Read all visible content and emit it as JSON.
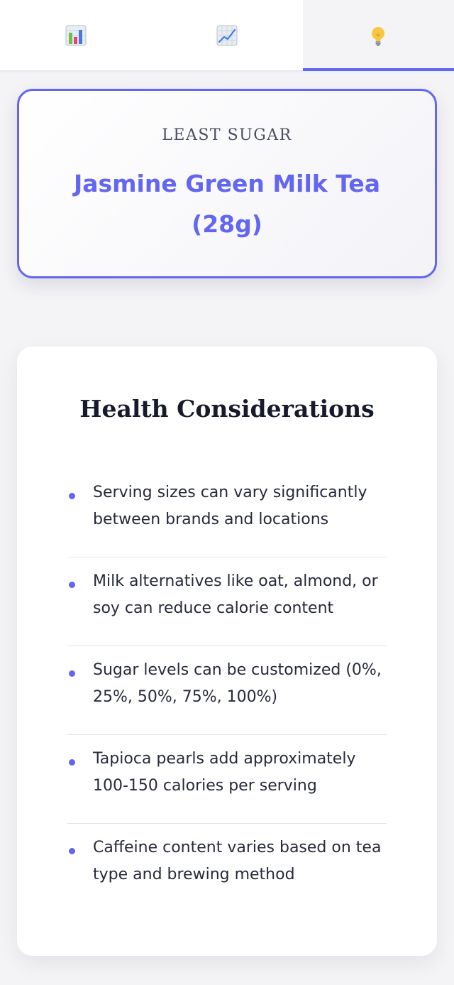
{
  "tabs": [
    {
      "icon": "bar-chart-icon"
    },
    {
      "icon": "trend-line-icon"
    },
    {
      "icon": "lightbulb-icon",
      "active": true
    }
  ],
  "highlight": {
    "label": "LEAST SUGAR",
    "value": "Jasmine Green Milk Tea (28g)"
  },
  "health": {
    "title": "Health Considerations",
    "items": [
      "Serving sizes can vary significantly between brands and locations",
      "Milk alternatives like oat, almond, or soy can reduce calorie content",
      "Sugar levels can be customized (0%, 25%, 50%, 75%, 100%)",
      "Tapioca pearls add approximately 100-150 calories per serving",
      "Caffeine content varies based on tea type and brewing method"
    ]
  },
  "colors": {
    "accent": "#6366f1",
    "background": "#f4f4f6"
  }
}
